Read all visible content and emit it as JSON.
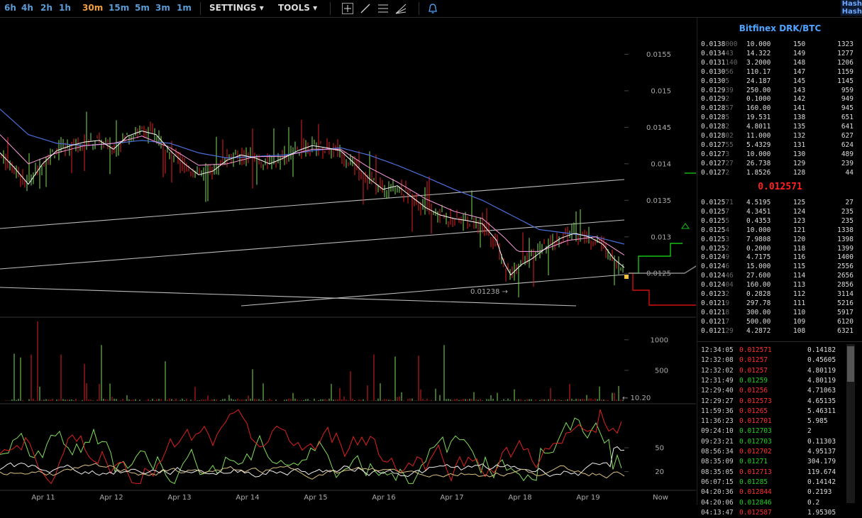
{
  "toolbar": {
    "timeframes": [
      "6h",
      "4h",
      "2h",
      "1h",
      "30m",
      "15m",
      "5m",
      "3m",
      "1m"
    ],
    "active_timeframe": "30m",
    "settings_label": "SETTINGS",
    "tools_label": "TOOLS",
    "corner_text": [
      "Hash",
      "Hash"
    ]
  },
  "orderbook": {
    "title": "Bitfinex DRK/BTC",
    "asks": [
      [
        "0.0138",
        "000",
        "10.000",
        "150",
        "1323"
      ],
      [
        "0.0134",
        "43",
        "14.322",
        "149",
        "1277"
      ],
      [
        "0.0131",
        "140",
        "3.2000",
        "148",
        "1206"
      ],
      [
        "0.0130",
        "56",
        "110.17",
        "147",
        "1159"
      ],
      [
        "0.0130",
        "5",
        "24.187",
        "145",
        "1145"
      ],
      [
        "0.0129",
        "39",
        "250.00",
        "143",
        "959"
      ],
      [
        "0.0129",
        "2",
        "0.1000",
        "142",
        "949"
      ],
      [
        "0.0128",
        "57",
        "160.00",
        "141",
        "945"
      ],
      [
        "0.0128",
        "5",
        "19.531",
        "138",
        "651"
      ],
      [
        "0.0128",
        "2",
        "4.8011",
        "135",
        "641"
      ],
      [
        "0.0128",
        "02",
        "11.000",
        "132",
        "627"
      ],
      [
        "0.0127",
        "55",
        "5.4329",
        "131",
        "624"
      ],
      [
        "0.0127",
        "3",
        "10.000",
        "130",
        "489"
      ],
      [
        "0.0127",
        "27",
        "26.738",
        "129",
        "239"
      ],
      [
        "0.0127",
        "2",
        "1.8526",
        "128",
        "44"
      ]
    ],
    "last_price": "0.012571",
    "bids": [
      [
        "0.0125",
        "71",
        "4.5195",
        "125",
        "27"
      ],
      [
        "0.0125",
        "7",
        "4.3451",
        "124",
        "235"
      ],
      [
        "0.0125",
        "5",
        "0.4353",
        "123",
        "235"
      ],
      [
        "0.0125",
        "4",
        "10.000",
        "121",
        "1338"
      ],
      [
        "0.0125",
        "3",
        "7.9808",
        "120",
        "1398"
      ],
      [
        "0.0125",
        "2",
        "0.2000",
        "118",
        "1399"
      ],
      [
        "0.0124",
        "9",
        "4.7175",
        "116",
        "1400"
      ],
      [
        "0.0124",
        "6",
        "15.000",
        "115",
        "2556"
      ],
      [
        "0.0124",
        "46",
        "27.600",
        "114",
        "2656"
      ],
      [
        "0.0124",
        "04",
        "160.00",
        "113",
        "2856"
      ],
      [
        "0.0123",
        "2",
        "0.2828",
        "112",
        "3114"
      ],
      [
        "0.0121",
        "9",
        "297.78",
        "111",
        "5216"
      ],
      [
        "0.0121",
        "8",
        "300.00",
        "110",
        "5917"
      ],
      [
        "0.0121",
        "7",
        "500.00",
        "109",
        "6120"
      ],
      [
        "0.0121",
        "29",
        "4.2872",
        "108",
        "6321"
      ]
    ]
  },
  "trades": [
    {
      "time": "12:34:05",
      "price": "0.012571",
      "dir": "down",
      "vol": "0.14182"
    },
    {
      "time": "12:32:08",
      "price": "0.01257",
      "dir": "down",
      "vol": "0.45605"
    },
    {
      "time": "12:32:02",
      "price": "0.01257",
      "dir": "down",
      "vol": "4.80119"
    },
    {
      "time": "12:31:49",
      "price": "0.01259",
      "dir": "up",
      "vol": "4.80119"
    },
    {
      "time": "12:29:40",
      "price": "0.01256",
      "dir": "down",
      "vol": "4.71063"
    },
    {
      "time": "12:29:27",
      "price": "0.012573",
      "dir": "down",
      "vol": "4.65135"
    },
    {
      "time": "11:59:36",
      "price": "0.01265",
      "dir": "down",
      "vol": "5.46311"
    },
    {
      "time": "11:36:23",
      "price": "0.012701",
      "dir": "down",
      "vol": "5.985"
    },
    {
      "time": "09:24:10",
      "price": "0.012703",
      "dir": "up",
      "vol": "2"
    },
    {
      "time": "09:23:21",
      "price": "0.012703",
      "dir": "up",
      "vol": "0.11303"
    },
    {
      "time": "08:56:34",
      "price": "0.012702",
      "dir": "down",
      "vol": "4.95137"
    },
    {
      "time": "08:35:09",
      "price": "0.01271",
      "dir": "up",
      "vol": "304.179"
    },
    {
      "time": "08:35:05",
      "price": "0.012713",
      "dir": "down",
      "vol": "119.674"
    },
    {
      "time": "06:07:15",
      "price": "0.01285",
      "dir": "up",
      "vol": "0.14142"
    },
    {
      "time": "04:20:36",
      "price": "0.012844",
      "dir": "down",
      "vol": "0.2193"
    },
    {
      "time": "04:20:06",
      "price": "0.012846",
      "dir": "up",
      "vol": "0.2"
    },
    {
      "time": "04:13:47",
      "price": "0.012587",
      "dir": "down",
      "vol": "1.95305"
    }
  ],
  "chart_data": {
    "type": "candlestick",
    "price_axis": {
      "ticks": [
        "0.0155",
        "0.015",
        "0.0145",
        "0.014",
        "0.0135",
        "0.013",
        "0.0125"
      ],
      "range": [
        0.0119,
        0.016
      ]
    },
    "volume_axis": {
      "ticks": [
        "1000",
        "500"
      ],
      "range": [
        0,
        1300
      ],
      "current_label": "← 10.20"
    },
    "oscillator_axis": {
      "ticks": [
        "50",
        "20"
      ],
      "range": [
        0,
        100
      ]
    },
    "x_ticks": [
      "Apr 11",
      "Apr 12",
      "Apr 13",
      "Apr 14",
      "Apr 15",
      "Apr 16",
      "Apr 17",
      "Apr 18",
      "Apr 19",
      "Now"
    ],
    "annotation": "0.01238 →",
    "price_path": [
      [
        0,
        0.01415
      ],
      [
        20,
        0.01395
      ],
      [
        40,
        0.01372
      ],
      [
        60,
        0.014
      ],
      [
        80,
        0.01418
      ],
      [
        100,
        0.01425
      ],
      [
        120,
        0.0143
      ],
      [
        140,
        0.01432
      ],
      [
        160,
        0.0142
      ],
      [
        180,
        0.01438
      ],
      [
        200,
        0.01445
      ],
      [
        220,
        0.0144
      ],
      [
        240,
        0.01418
      ],
      [
        260,
        0.014
      ],
      [
        280,
        0.01385
      ],
      [
        300,
        0.0139
      ],
      [
        320,
        0.01405
      ],
      [
        340,
        0.01412
      ],
      [
        360,
        0.01408
      ],
      [
        380,
        0.014
      ],
      [
        400,
        0.01408
      ],
      [
        420,
        0.01418
      ],
      [
        440,
        0.01425
      ],
      [
        460,
        0.01422
      ],
      [
        480,
        0.01418
      ],
      [
        500,
        0.014
      ],
      [
        520,
        0.0138
      ],
      [
        540,
        0.01365
      ],
      [
        560,
        0.0137
      ],
      [
        580,
        0.01355
      ],
      [
        600,
        0.0134
      ],
      [
        620,
        0.0133
      ],
      [
        640,
        0.01325
      ],
      [
        660,
        0.01322
      ],
      [
        680,
        0.01318
      ],
      [
        700,
        0.01295
      ],
      [
        710,
        0.01265
      ],
      [
        720,
        0.01248
      ],
      [
        735,
        0.01262
      ],
      [
        750,
        0.0127
      ],
      [
        770,
        0.01285
      ],
      [
        790,
        0.01298
      ],
      [
        810,
        0.01305
      ],
      [
        830,
        0.013
      ],
      [
        850,
        0.0129
      ],
      [
        865,
        0.0127
      ],
      [
        880,
        0.01258
      ]
    ],
    "ma_fast": [
      [
        0,
        0.0144
      ],
      [
        40,
        0.014
      ],
      [
        80,
        0.01415
      ],
      [
        120,
        0.01425
      ],
      [
        160,
        0.01428
      ],
      [
        200,
        0.01438
      ],
      [
        240,
        0.01422
      ],
      [
        280,
        0.01398
      ],
      [
        320,
        0.014
      ],
      [
        360,
        0.0141
      ],
      [
        400,
        0.0141
      ],
      [
        440,
        0.0142
      ],
      [
        480,
        0.0142
      ],
      [
        520,
        0.01395
      ],
      [
        560,
        0.01375
      ],
      [
        600,
        0.01352
      ],
      [
        640,
        0.01335
      ],
      [
        680,
        0.01325
      ],
      [
        710,
        0.013
      ],
      [
        730,
        0.0128
      ],
      [
        760,
        0.0128
      ],
      [
        800,
        0.01295
      ],
      [
        840,
        0.013
      ],
      [
        880,
        0.01275
      ]
    ],
    "ma_slow": [
      [
        0,
        0.01475
      ],
      [
        40,
        0.0144
      ],
      [
        80,
        0.01428
      ],
      [
        120,
        0.01425
      ],
      [
        160,
        0.01428
      ],
      [
        200,
        0.01432
      ],
      [
        240,
        0.01428
      ],
      [
        280,
        0.01415
      ],
      [
        320,
        0.01408
      ],
      [
        360,
        0.0141
      ],
      [
        400,
        0.01412
      ],
      [
        440,
        0.01418
      ],
      [
        480,
        0.01422
      ],
      [
        520,
        0.01412
      ],
      [
        560,
        0.01398
      ],
      [
        600,
        0.01382
      ],
      [
        640,
        0.01365
      ],
      [
        680,
        0.0135
      ],
      [
        720,
        0.0133
      ],
      [
        760,
        0.0131
      ],
      [
        800,
        0.01305
      ],
      [
        840,
        0.013
      ],
      [
        880,
        0.0129
      ]
    ]
  }
}
